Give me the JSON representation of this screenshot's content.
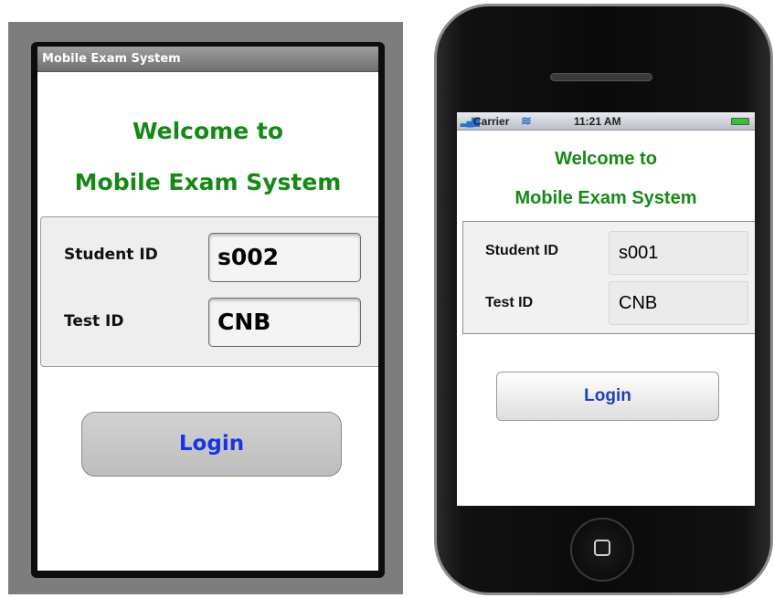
{
  "android": {
    "title_bar": "Mobile Exam System",
    "welcome_line1": "Welcome to",
    "welcome_line2": "Mobile Exam System",
    "student_id_label": "Student ID",
    "student_id_value": "s002",
    "test_id_label": "Test ID",
    "test_id_value": "CNB",
    "login_label": "Login"
  },
  "iphone": {
    "status_bar": {
      "carrier": "Carrier",
      "time": "11:21 AM"
    },
    "welcome_line1": "Welcome to",
    "welcome_line2": "Mobile Exam System",
    "student_id_label": "Student ID",
    "student_id_value": "s001",
    "test_id_label": "Test ID",
    "test_id_value": "CNB",
    "login_label": "Login"
  },
  "colors": {
    "welcome_green": "#138a13",
    "login_blue": "#1a33e6"
  },
  "icons": [
    "signal-bars-icon",
    "wifi-icon",
    "battery-icon",
    "home-button-icon"
  ]
}
